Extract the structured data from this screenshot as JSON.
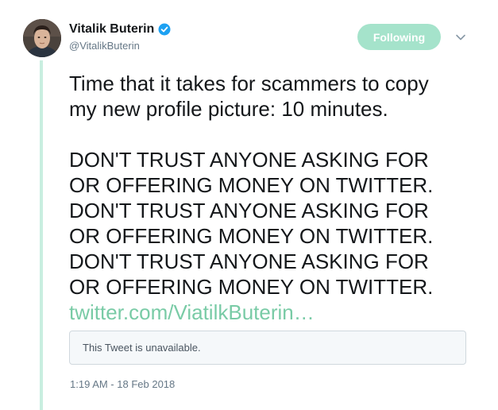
{
  "author": {
    "display_name": "Vitalik Buterin",
    "handle": "@VitalikButerin",
    "verified": true,
    "avatar_icon": "profile-photo"
  },
  "follow": {
    "label": "Following",
    "color": "#a5e3cb"
  },
  "menu": {
    "icon": "chevron-down-icon"
  },
  "tweet": {
    "line_1": "Time that it takes for scammers to copy",
    "line_2": "my new profile picture: 10 minutes.",
    "line_3": "DON'T TRUST ANYONE ASKING FOR",
    "line_4": "OR OFFERING MONEY ON TWITTER.",
    "line_5": "DON'T TRUST ANYONE ASKING FOR",
    "line_6": "OR OFFERING MONEY ON TWITTER.",
    "line_7": "DON'T TRUST ANYONE ASKING FOR",
    "line_8": "OR OFFERING MONEY ON TWITTER.",
    "link": "twitter.com/ViatilkButerin…",
    "link_color": "#79cba6"
  },
  "quote": {
    "text": "This Tweet is unavailable."
  },
  "meta": {
    "timestamp": "1:19 AM - 18 Feb 2018"
  },
  "theme": {
    "thread_line_color": "#c9eee0",
    "verified_color": "#1da1f2"
  }
}
